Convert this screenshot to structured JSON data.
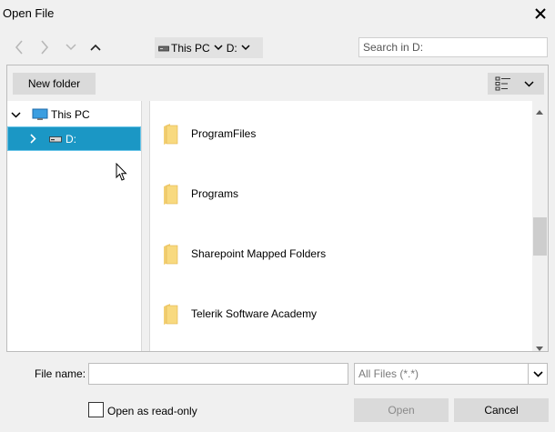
{
  "window": {
    "title": "Open File"
  },
  "nav": {
    "crumbs": [
      {
        "label": "This PC",
        "icon": "drive-icon"
      },
      {
        "label": "D:"
      }
    ],
    "search_placeholder": "Search in D:"
  },
  "toolbar": {
    "new_folder_label": "New folder"
  },
  "tree": {
    "root": {
      "label": "This PC",
      "icon": "computer-icon",
      "expanded": true
    },
    "selected": {
      "label": "D:",
      "icon": "drive-icon",
      "selected_color": "#1b97c5"
    }
  },
  "files": [
    {
      "name": "ProgramFiles"
    },
    {
      "name": "Programs"
    },
    {
      "name": "Sharepoint Mapped Folders"
    },
    {
      "name": "Telerik Software Academy"
    }
  ],
  "footer": {
    "file_name_label": "File name:",
    "file_name_value": "",
    "filter_value": "All Files (*.*)",
    "readonly_label": "Open as read-only",
    "open_label": "Open",
    "cancel_label": "Cancel"
  }
}
